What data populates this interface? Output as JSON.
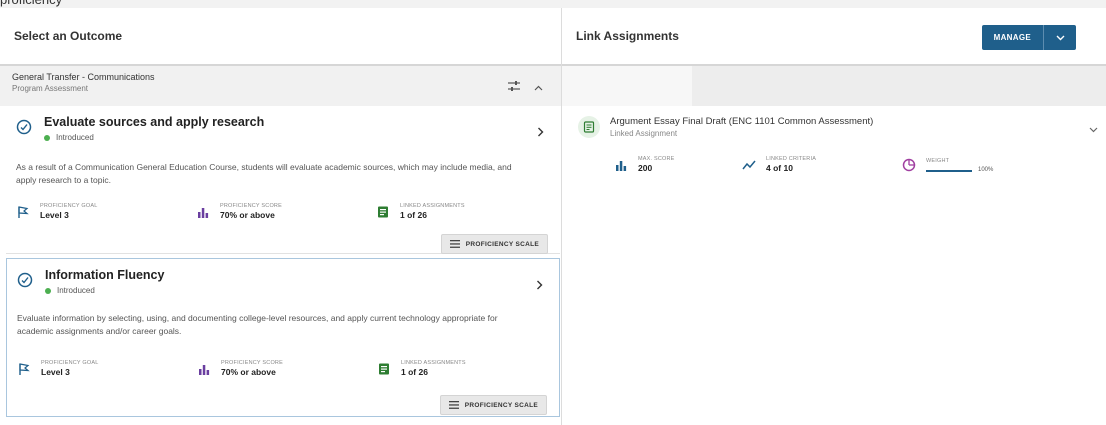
{
  "top_fragment": "proficiency",
  "left": {
    "title": "Select an Outcome",
    "group": {
      "title": "General Transfer - Communications",
      "subtitle": "Program Assessment"
    },
    "outcomes": [
      {
        "title": "Evaluate sources and apply research",
        "status": "Introduced",
        "description": "As a result of a Communication General Education Course, students will evaluate academic sources, which may include media, and apply research to a topic.",
        "metrics": [
          {
            "label": "PROFICIENCY GOAL",
            "value": "Level 3",
            "icon": "flag-icon"
          },
          {
            "label": "PROFICIENCY SCORE",
            "value": "70% or above",
            "icon": "bar-chart-icon"
          },
          {
            "label": "LINKED ASSIGNMENTS",
            "value": "1 of 26",
            "icon": "assignment-icon"
          }
        ],
        "button": "PROFICIENCY SCALE"
      },
      {
        "title": "Information Fluency",
        "status": "Introduced",
        "description": "Evaluate information by selecting, using, and documenting college-level resources, and apply current technology appropriate for academic assignments and/or career goals.",
        "metrics": [
          {
            "label": "PROFICIENCY GOAL",
            "value": "Level 3",
            "icon": "flag-icon"
          },
          {
            "label": "PROFICIENCY SCORE",
            "value": "70% or above",
            "icon": "bar-chart-icon"
          },
          {
            "label": "LINKED ASSIGNMENTS",
            "value": "1 of 26",
            "icon": "assignment-icon"
          }
        ],
        "button": "PROFICIENCY SCALE"
      }
    ]
  },
  "right": {
    "title": "Link Assignments",
    "manage_label": "MANAGE",
    "assignment": {
      "title": "Argument Essay Final Draft (ENC 1101 Common Assessment)",
      "subtitle": "Linked Assignment",
      "metrics": {
        "max_score_label": "MAX. SCORE",
        "max_score": "200",
        "criteria_label": "LINKED CRITERIA",
        "criteria": "4 of 10",
        "weight_label": "WEIGHT",
        "weight": "100%"
      }
    }
  },
  "colors": {
    "accent": "#1f5f8b",
    "status_green": "#4caf50",
    "selected_border": "#a9c6de"
  }
}
